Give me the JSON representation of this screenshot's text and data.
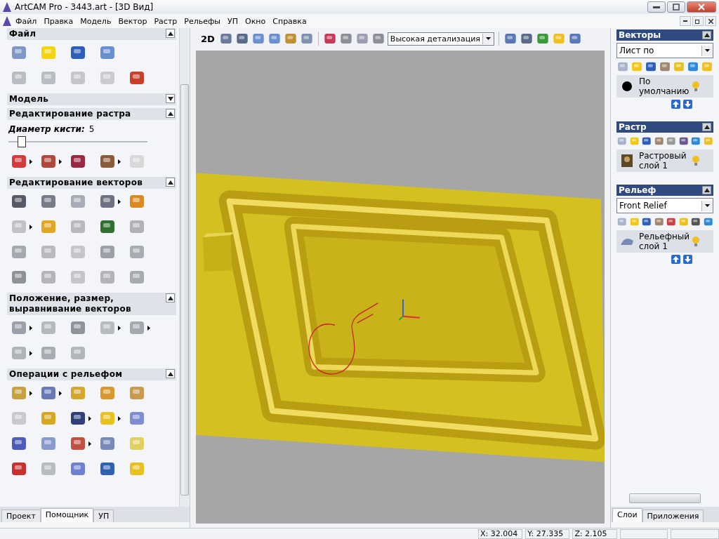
{
  "window": {
    "title": "ArtCAM Pro - 3443.art - [3D Вид]"
  },
  "menu": [
    "Файл",
    "Правка",
    "Модель",
    "Вектор",
    "Растр",
    "Рельефы",
    "УП",
    "Окно",
    "Справка"
  ],
  "left_panel": {
    "sections": [
      {
        "title": "Файл",
        "expanded": true
      },
      {
        "title": "Модель",
        "expanded": false
      },
      {
        "title": "Редактирование растра",
        "expanded": true,
        "brush": {
          "label": "Диаметр кисти:",
          "value": "5",
          "level": 0.07
        }
      },
      {
        "title": "Редактирование векторов",
        "expanded": true
      },
      {
        "title": "Положение, размер, выравнивание векторов",
        "expanded": true
      },
      {
        "title": "Операции с рельефом",
        "expanded": true
      }
    ],
    "tabs": [
      {
        "label": "Проект",
        "selected": false
      },
      {
        "label": "Помощник",
        "selected": true
      },
      {
        "label": "УП",
        "selected": false
      }
    ]
  },
  "view_toolbar": {
    "mode": "2D",
    "detail": "Высокая детализация"
  },
  "right_panel": {
    "sections": [
      {
        "title": "Векторы",
        "expanded": true,
        "dropdown": "Лист по",
        "layer": "По умолчанию",
        "order_arrows": true
      },
      {
        "title": "Растр",
        "expanded": true,
        "layer": "Растровый слой 1",
        "order_arrows": false
      },
      {
        "title": "Рельеф",
        "expanded": true,
        "dropdown": "Front Relief",
        "layer": "Рельефный слой 1",
        "order_arrows": true
      }
    ],
    "tabs": [
      {
        "label": "Слои",
        "selected": true
      },
      {
        "label": "Приложения",
        "selected": false
      }
    ]
  },
  "status_bar": [
    "X: 32.004",
    "Y: 27.335",
    "Z: 2.105"
  ]
}
